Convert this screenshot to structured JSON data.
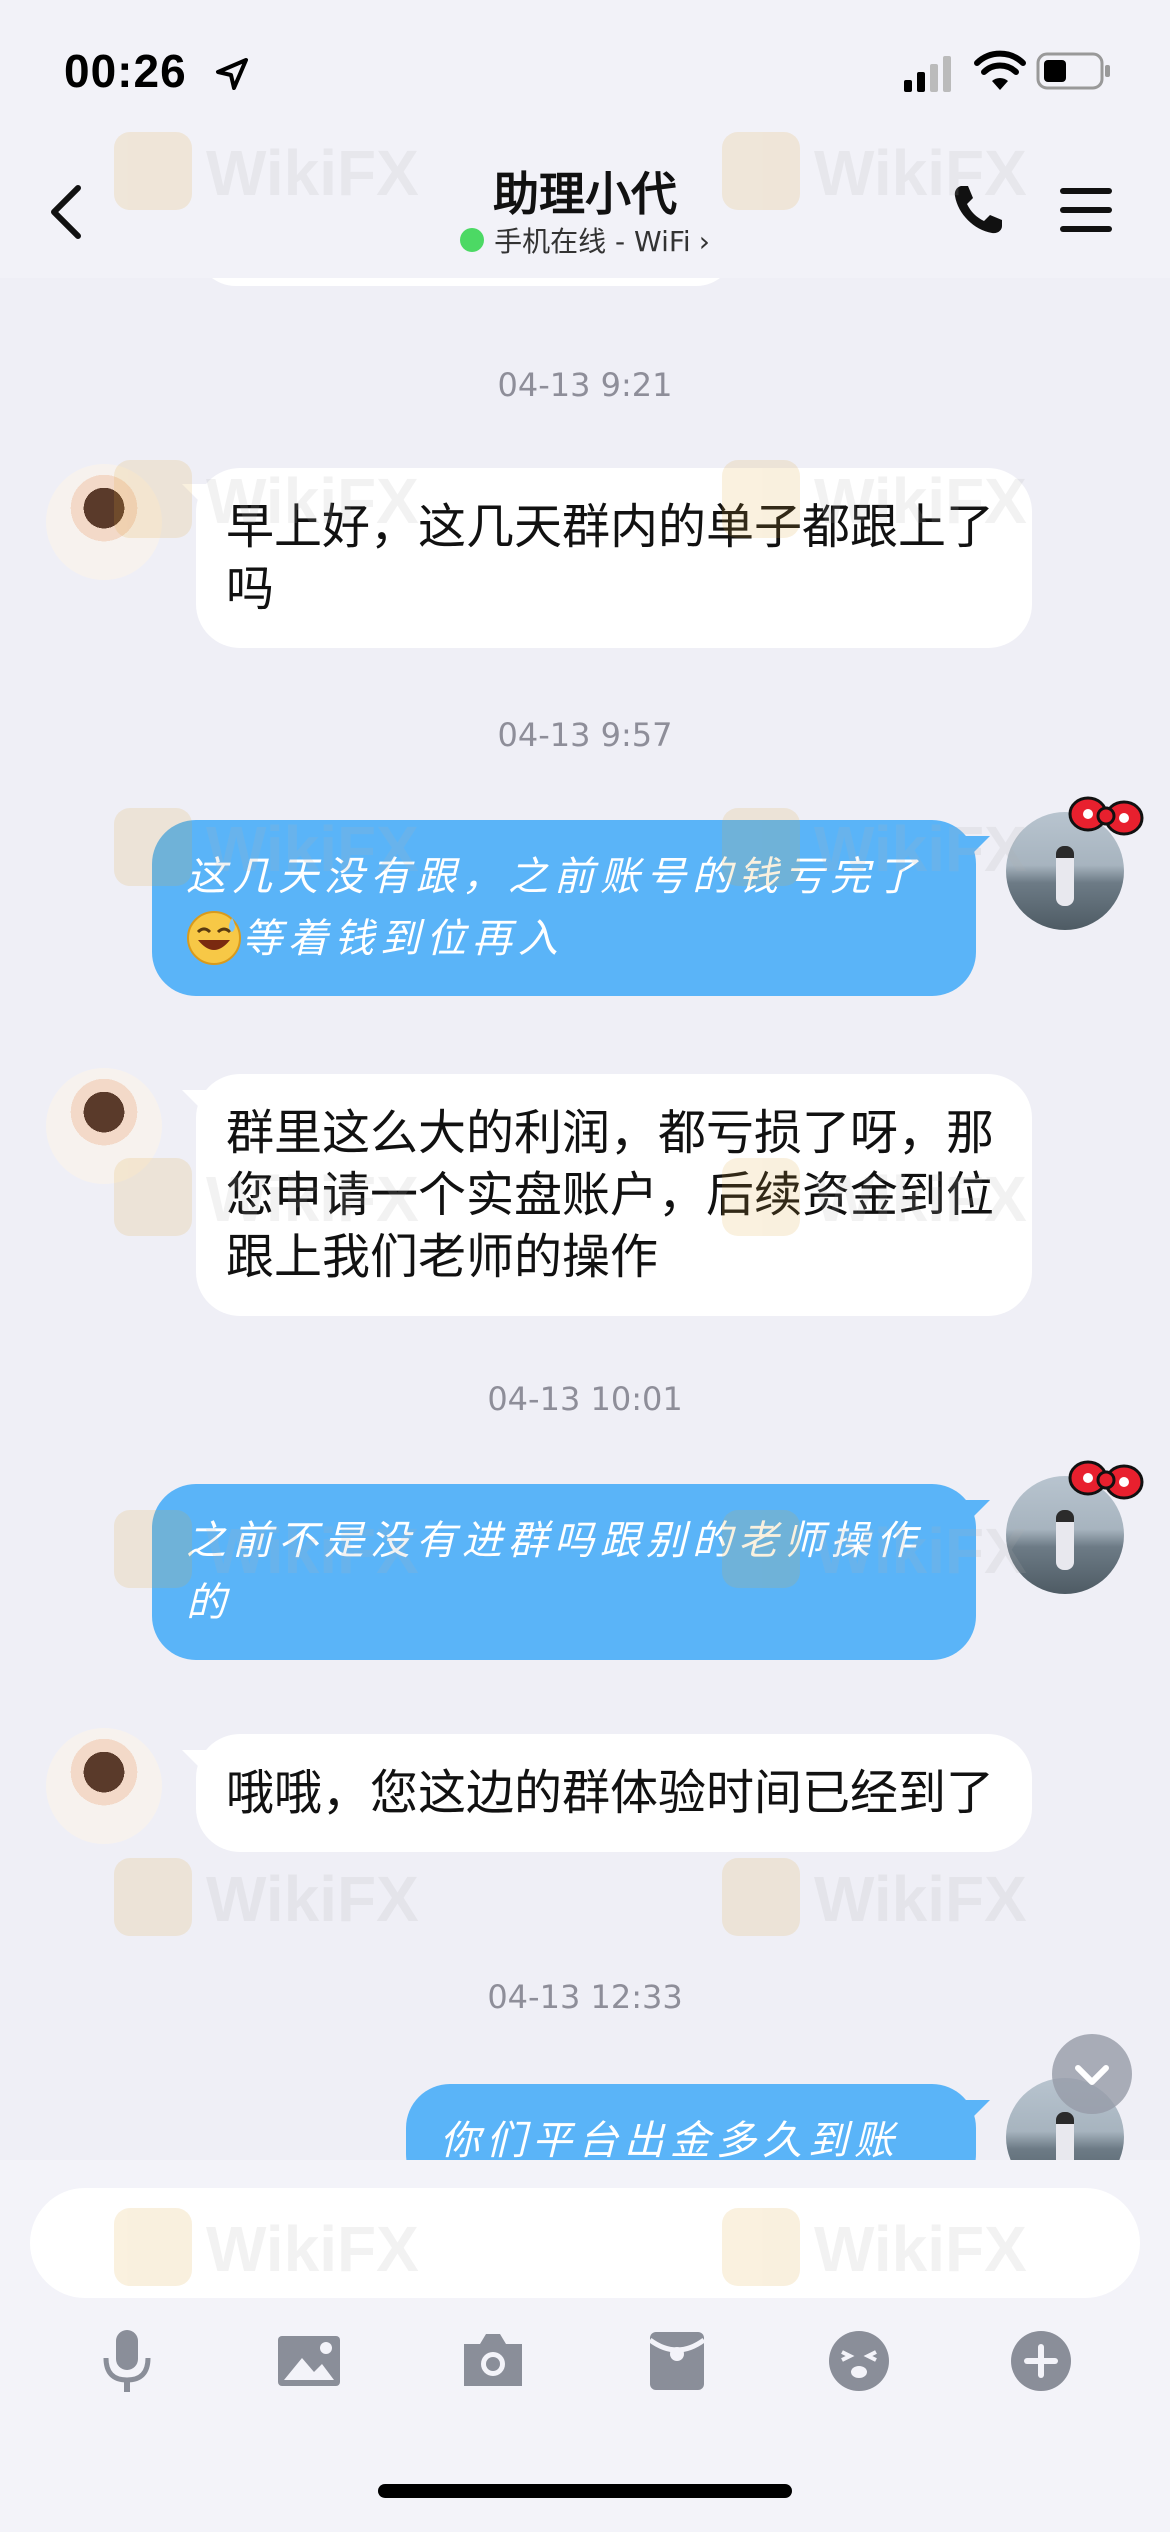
{
  "status_bar": {
    "time": "00:26"
  },
  "header": {
    "title": "助理小代",
    "status_text": "手机在线 - WiFi",
    "status_chevron": "›"
  },
  "messages": [
    {
      "type": "timestamp",
      "text": "04-13 9:21"
    },
    {
      "type": "incoming",
      "text": "早上好，这几天群内的单子都跟上了吗"
    },
    {
      "type": "timestamp",
      "text": "04-13 9:57"
    },
    {
      "type": "outgoing",
      "text_before_emoji": "这几天没有跟，之前账号的钱亏完了",
      "emoji": "grinning-sweat-emoji",
      "text_after_emoji": "等着钱到位再入"
    },
    {
      "type": "incoming",
      "text": "群里这么大的利润，都亏损了呀，那您申请一个实盘账户，后续资金到位跟上我们老师的操作"
    },
    {
      "type": "timestamp",
      "text": "04-13 10:01"
    },
    {
      "type": "outgoing",
      "text": "之前不是没有进群吗跟别的老师操作的"
    },
    {
      "type": "incoming",
      "text": "哦哦，您这边的群体验时间已经到了"
    },
    {
      "type": "timestamp",
      "text": "04-13 12:33"
    },
    {
      "type": "outgoing",
      "text": "你们平台出金多久到账"
    }
  ],
  "input": {
    "placeholder": ""
  },
  "toolbar": [
    "microphone-icon",
    "image-icon",
    "camera-icon",
    "red-packet-icon",
    "sticker-icon",
    "plus-icon"
  ],
  "watermark": {
    "text": "WikiFX"
  },
  "colors": {
    "outgoing_bubble": "#5AB4F8",
    "incoming_bubble": "#FFFFFF",
    "background": "#EFEFF6",
    "online_dot": "#4CD964"
  }
}
